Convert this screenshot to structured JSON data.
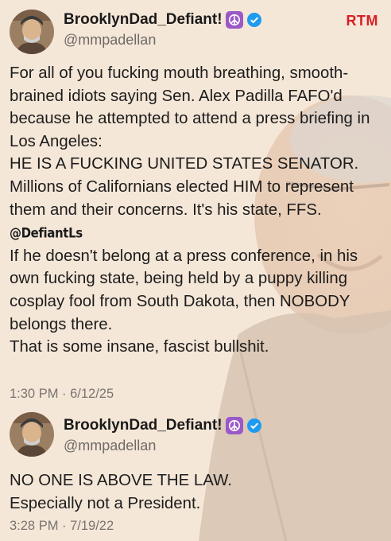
{
  "brand": {
    "logo_text": "RTM",
    "color": "#d81f26"
  },
  "tweets": [
    {
      "display_name": "BrooklynDad_Defiant!",
      "handle": "@mmpadellan",
      "badge_icon": "peace-sign-icon",
      "verified_icon": "verified-badge-icon",
      "paragraphs": [
        "For all of you fucking mouth breathing, smooth-brained idiots saying Sen. Alex Padilla FAFO'd because he attempted to attend a press briefing in Los Angeles:",
        "HE IS A FUCKING UNITED STATES SENATOR. Millions of Californians elected HIM to represent them and their concerns. It's his state, FFS.",
        "If he doesn't belong at a press conference, in his own fucking state, being held by a puppy killing cosplay fool from South Dakota, then NOBODY belongs there.",
        "That is some insane, fascist bullshit."
      ],
      "inline_tag": "@DefiantLs",
      "timestamp": "1:30 PM · 6/12/25"
    },
    {
      "display_name": "BrooklynDad_Defiant!",
      "handle": "@mmpadellan",
      "badge_icon": "peace-sign-icon",
      "verified_icon": "verified-badge-icon",
      "paragraphs": [
        "NO ONE IS ABOVE THE LAW.",
        "Especially not a President."
      ],
      "timestamp": "3:28 PM · 7/19/22"
    }
  ],
  "colors": {
    "background": "#f5e7d8",
    "peace_badge": "#9b59c8",
    "verified": "#1d9bf0"
  }
}
